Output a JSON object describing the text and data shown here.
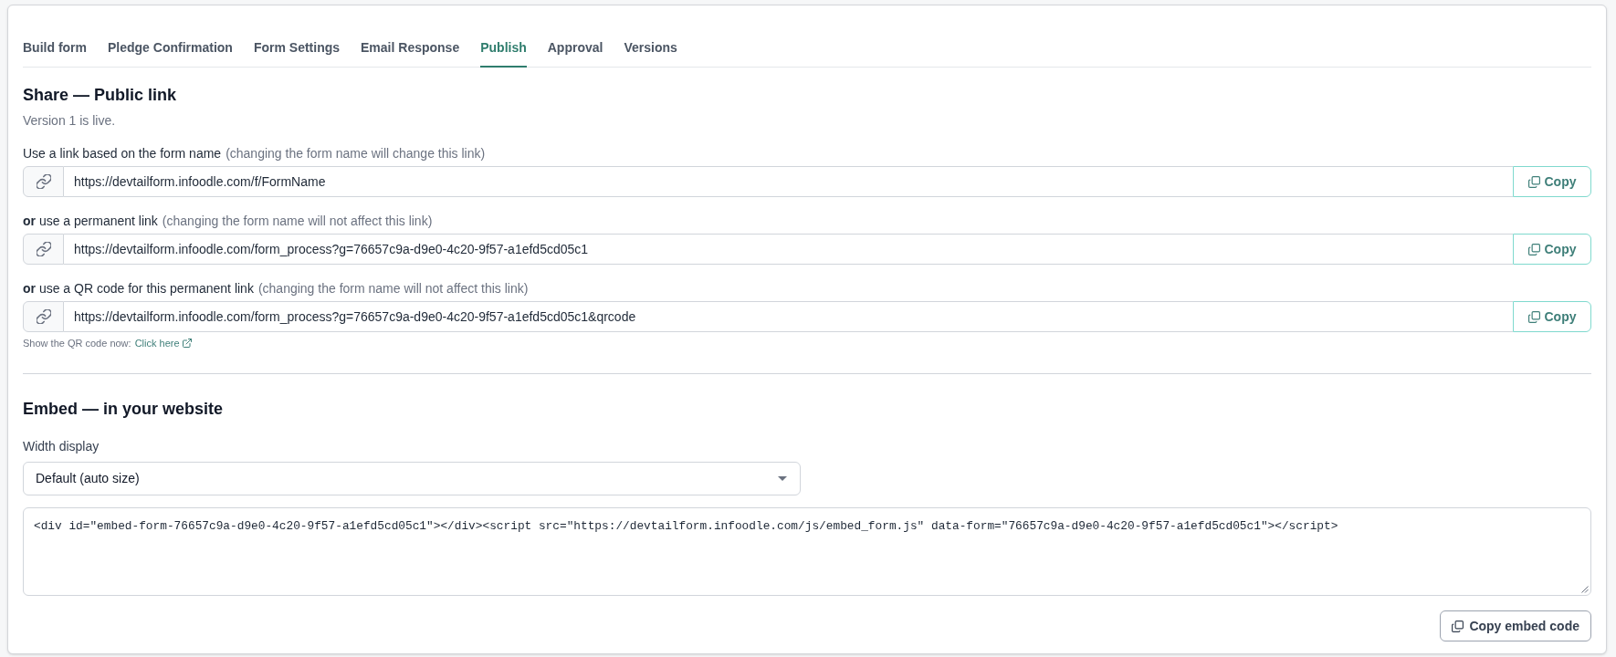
{
  "tabs": [
    {
      "label": "Build form",
      "selected": false
    },
    {
      "label": "Pledge Confirmation",
      "selected": false
    },
    {
      "label": "Form Settings",
      "selected": false
    },
    {
      "label": "Email Response",
      "selected": false
    },
    {
      "label": "Publish",
      "selected": true
    },
    {
      "label": "Approval",
      "selected": false
    },
    {
      "label": "Versions",
      "selected": false
    }
  ],
  "share": {
    "title": "Share — Public link",
    "status": "Version 1 is live.",
    "links": [
      {
        "label": "Use a link based on the form name",
        "hint": "(changing the form name will change this link)",
        "url": "https://devtailform.infoodle.com/f/FormName",
        "button": "Copy"
      },
      {
        "label": "**or** use a permanent link",
        "hint": "(changing the form name will not affect this link)",
        "url": "https://devtailform.infoodle.com/form_process?g=76657c9a-d9e0-4c20-9f57-a1efd5cd05c1",
        "button": "Copy"
      },
      {
        "label": "**or** use a QR code for this permanent link",
        "hint": "(changing the form name will not affect this link)",
        "url": "https://devtailform.infoodle.com/form_process?g=76657c9a-d9e0-4c20-9f57-a1efd5cd05c1&qrcode",
        "button": "Copy"
      }
    ],
    "qr_note": "Show the QR code now:",
    "qr_link": "Click here"
  },
  "embed": {
    "title": "Embed — in your website",
    "width_label": "Width display",
    "width_select": "Default (auto size)",
    "code": "<div id=\"embed-form-76657c9a-d9e0-4c20-9f57-a1efd5cd05c1\"></div><script src=\"https://devtailform.infoodle.com/js/embed_form.js\" data-form=\"76657c9a-d9e0-4c20-9f57-a1efd5cd05c1\"></script>",
    "button": "Copy embed code"
  }
}
